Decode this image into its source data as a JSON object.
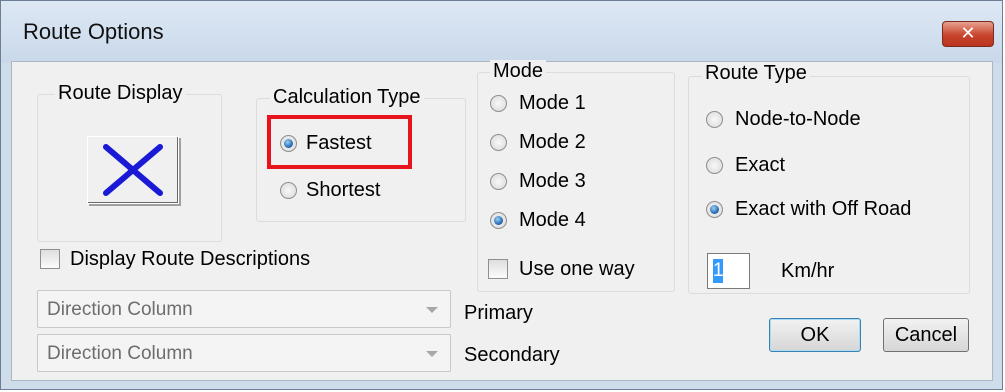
{
  "window": {
    "title": "Route Options"
  },
  "route_display": {
    "label": "Route Display",
    "icon": "blue-x-icon",
    "icon_color": "#1a1ad6"
  },
  "calculation_type": {
    "label": "Calculation Type",
    "options": [
      {
        "label": "Fastest",
        "selected": true
      },
      {
        "label": "Shortest",
        "selected": false
      }
    ],
    "highlight_color": "#e8141b"
  },
  "mode": {
    "label": "Mode",
    "options": [
      {
        "label": "Mode 1",
        "selected": false
      },
      {
        "label": "Mode 2",
        "selected": false
      },
      {
        "label": "Mode 3",
        "selected": false
      },
      {
        "label": "Mode 4",
        "selected": true
      }
    ],
    "use_one_way": {
      "label": "Use one way",
      "checked": false
    }
  },
  "route_type": {
    "label": "Route Type",
    "options": [
      {
        "label": "Node-to-Node",
        "selected": false
      },
      {
        "label": "Exact",
        "selected": false
      },
      {
        "label": "Exact with Off Road",
        "selected": true
      }
    ],
    "speed_value": "1",
    "speed_unit": "Km/hr"
  },
  "descriptions": {
    "checkbox_label": "Display Route Descriptions",
    "checked": false,
    "primary": {
      "value": "Direction Column",
      "label": "Primary"
    },
    "secondary": {
      "value": "Direction Column",
      "label": "Secondary"
    }
  },
  "buttons": {
    "ok": "OK",
    "cancel": "Cancel"
  }
}
